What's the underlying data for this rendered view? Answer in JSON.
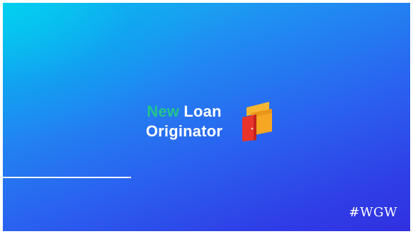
{
  "slide": {
    "title_line1_accent": "New",
    "title_line1_rest": "Loan",
    "title_line2": "Originator",
    "hashtag": "#WGW"
  },
  "colors": {
    "accent_text": "#22c58a",
    "logo_orange": "#f5a623",
    "logo_red": "#e8342b",
    "background_start": "#10c4ee",
    "background_end": "#3030e0"
  },
  "icons": {
    "logo": "wallet-door-icon"
  }
}
